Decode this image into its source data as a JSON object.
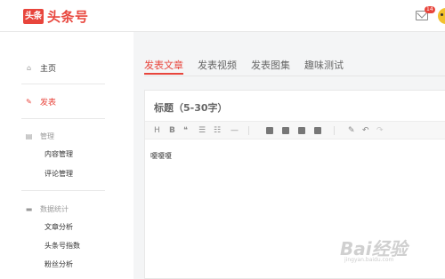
{
  "header": {
    "logo_mark": "头条",
    "logo_text": "头条号",
    "notification_count": "14"
  },
  "sidebar": {
    "home": "主页",
    "publish": "发表",
    "manage_group": "管理",
    "content_manage": "内容管理",
    "comment_manage": "评论管理",
    "stats_group": "数据统计",
    "article_analysis": "文章分析",
    "account_index": "头条号指数",
    "fans_analysis": "粉丝分析"
  },
  "tabs": [
    "发表文章",
    "发表视频",
    "发表图集",
    "趣味测试"
  ],
  "editor": {
    "title_placeholder": "标题（5-30字）",
    "body_text": "嗄嗄嗄",
    "toolbar": [
      "H",
      "B",
      "❝",
      "☰",
      "☷",
      "—"
    ]
  },
  "watermark": {
    "brand": "Bai经验",
    "url": "jingyan.baidu.com"
  },
  "colors": {
    "accent": "#e8453c"
  }
}
